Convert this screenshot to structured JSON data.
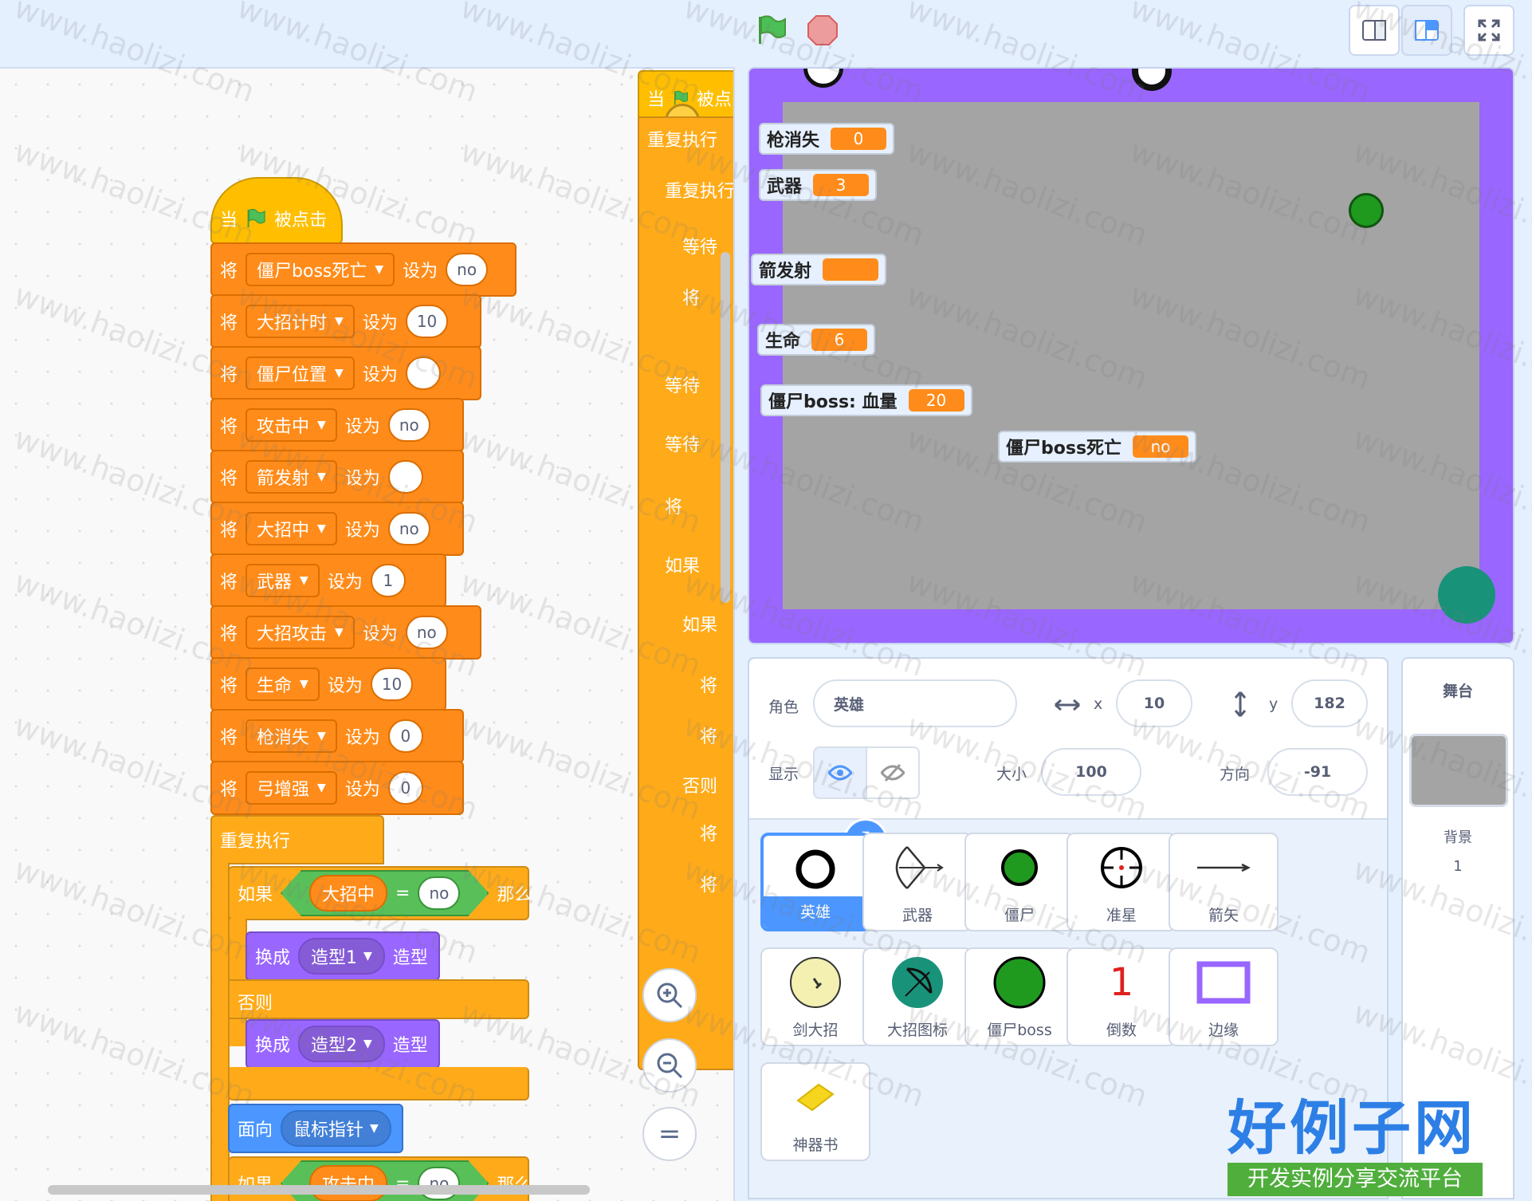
{
  "toolbar": {
    "flag_icon": "green-flag-icon",
    "stop_icon": "stop-sign-icon",
    "layout_small_icon": "small-stage-icon",
    "layout_normal_icon": "normal-stage-icon",
    "fullscreen_icon": "fullscreen-icon"
  },
  "script_main": {
    "hat": {
      "when": "当",
      "clicked": "被点击"
    },
    "set_rows": [
      {
        "verb": "将",
        "var": "僵尸boss死亡",
        "to": "设为",
        "value": "no"
      },
      {
        "verb": "将",
        "var": "大招计时",
        "to": "设为",
        "value": "10"
      },
      {
        "verb": "将",
        "var": "僵尸位置",
        "to": "设为",
        "value": ""
      },
      {
        "verb": "将",
        "var": "攻击中",
        "to": "设为",
        "value": "no"
      },
      {
        "verb": "将",
        "var": "箭发射",
        "to": "设为",
        "value": ""
      },
      {
        "verb": "将",
        "var": "大招中",
        "to": "设为",
        "value": "no"
      },
      {
        "verb": "将",
        "var": "武器",
        "to": "设为",
        "value": "1"
      },
      {
        "verb": "将",
        "var": "大招攻击",
        "to": "设为",
        "value": "no"
      },
      {
        "verb": "将",
        "var": "生命",
        "to": "设为",
        "value": "10"
      },
      {
        "verb": "将",
        "var": "枪消失",
        "to": "设为",
        "value": "0"
      },
      {
        "verb": "将",
        "var": "弓增强",
        "to": "设为",
        "value": "0"
      }
    ],
    "forever": "重复执行",
    "if1": {
      "if": "如果",
      "left": "大招中",
      "op": "=",
      "right": "no",
      "then": "那么"
    },
    "switch1": {
      "verb": "换成",
      "costume": "造型1",
      "suffix": "造型"
    },
    "else": "否则",
    "switch2": {
      "verb": "换成",
      "costume": "造型2",
      "suffix": "造型"
    },
    "point": {
      "verb": "面向",
      "target": "鼠标指针"
    },
    "if2": {
      "if": "如果",
      "left": "攻击中",
      "op": "=",
      "right": "no",
      "then": "那么"
    }
  },
  "script_side": {
    "hat_when": "当",
    "hat_clicked": "被点",
    "labels": [
      "重复执行",
      "重复执行",
      "等待",
      "将",
      "等待",
      "等待",
      "将",
      "如果",
      "如果",
      "将",
      "将",
      "否则",
      "将",
      "将"
    ]
  },
  "zoom": {
    "in": "+",
    "out": "−",
    "reset": "="
  },
  "stage": {
    "monitors": [
      {
        "label": "枪消失",
        "value": "0"
      },
      {
        "label": "武器",
        "value": "3"
      },
      {
        "label": "箭发射",
        "value": ""
      },
      {
        "label": "生命",
        "value": "6"
      },
      {
        "label": "僵尸boss: 血量",
        "value": "20"
      },
      {
        "label": "僵尸boss死亡",
        "value": "no"
      }
    ],
    "border_color": "#9966ff",
    "bg_color": "#a4a4a4"
  },
  "sprite_info": {
    "sprite_label": "角色",
    "sprite_name": "英雄",
    "x_label": "x",
    "x_value": "10",
    "y_label": "y",
    "y_value": "182",
    "show_label": "显示",
    "size_label": "大小",
    "size_value": "100",
    "direction_label": "方向",
    "direction_value": "-91"
  },
  "sprites": [
    {
      "name": "英雄",
      "icon": "ring-icon",
      "selected": true
    },
    {
      "name": "武器",
      "icon": "bow-icon",
      "selected": false
    },
    {
      "name": "僵尸",
      "icon": "green-dot-icon",
      "selected": false
    },
    {
      "name": "准星",
      "icon": "crosshair-icon",
      "selected": false
    },
    {
      "name": "箭矢",
      "icon": "arrow-icon",
      "selected": false
    },
    {
      "name": "剑大招",
      "icon": "sword-circle-icon",
      "selected": false
    },
    {
      "name": "大招图标",
      "icon": "bow-badge-icon",
      "selected": false
    },
    {
      "name": "僵尸boss",
      "icon": "big-green-dot-icon",
      "selected": false
    },
    {
      "name": "倒数",
      "icon": "number-one-icon",
      "selected": false
    },
    {
      "name": "边缘",
      "icon": "frame-icon",
      "selected": false
    },
    {
      "name": "神器书",
      "icon": "yellow-book-icon",
      "selected": false
    }
  ],
  "countdown_glyph": "1",
  "stage_pane": {
    "title": "舞台",
    "backdrop_label": "背景",
    "backdrop_count": "1"
  },
  "logo": {
    "title": "好例子网",
    "subtitle": "开发实例分享交流平台"
  },
  "watermark": "www.haolizi.com"
}
